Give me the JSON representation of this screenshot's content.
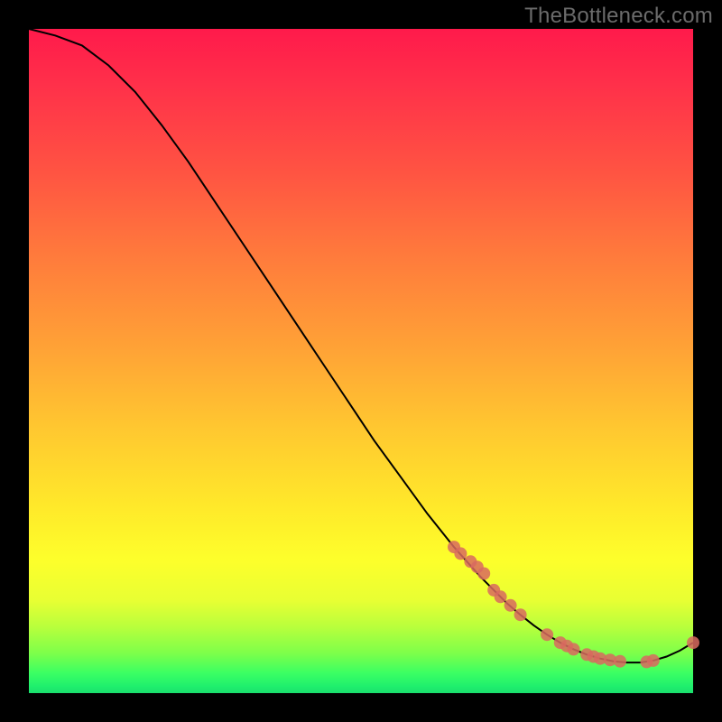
{
  "watermark": "TheBottleneck.com",
  "colors": {
    "background": "#000000",
    "line": "#000000",
    "marker": "#d86a5f",
    "gradient_top": "#ff1a4b",
    "gradient_bottom": "#1adf6d"
  },
  "chart_data": {
    "type": "line",
    "title": "",
    "xlabel": "",
    "ylabel": "",
    "xlim": [
      0,
      100
    ],
    "ylim": [
      0,
      100
    ],
    "x": [
      0,
      4,
      8,
      12,
      16,
      20,
      24,
      28,
      32,
      36,
      40,
      44,
      48,
      52,
      56,
      60,
      64,
      68,
      70,
      72,
      74,
      76,
      78,
      80,
      82,
      84,
      86,
      88,
      90,
      92,
      94,
      96,
      98,
      100
    ],
    "y": [
      100,
      99,
      97.5,
      94.5,
      90.5,
      85.5,
      80,
      74,
      68,
      62,
      56,
      50,
      44,
      38,
      32.5,
      27,
      22,
      17.5,
      15.5,
      13.5,
      11.8,
      10.2,
      8.8,
      7.6,
      6.6,
      5.8,
      5.2,
      4.8,
      4.6,
      4.6,
      4.9,
      5.5,
      6.4,
      7.6
    ],
    "markers": {
      "x": [
        64,
        65,
        66.5,
        67.5,
        68.5,
        70,
        71,
        72.5,
        74,
        78,
        80,
        81,
        82,
        84,
        85,
        86,
        87.5,
        89,
        93,
        94,
        100
      ],
      "y": [
        22,
        21,
        19.8,
        19,
        18,
        15.5,
        14.5,
        13.2,
        11.8,
        8.8,
        7.6,
        7.1,
        6.6,
        5.8,
        5.5,
        5.2,
        5.0,
        4.8,
        4.7,
        4.9,
        7.6
      ]
    }
  }
}
